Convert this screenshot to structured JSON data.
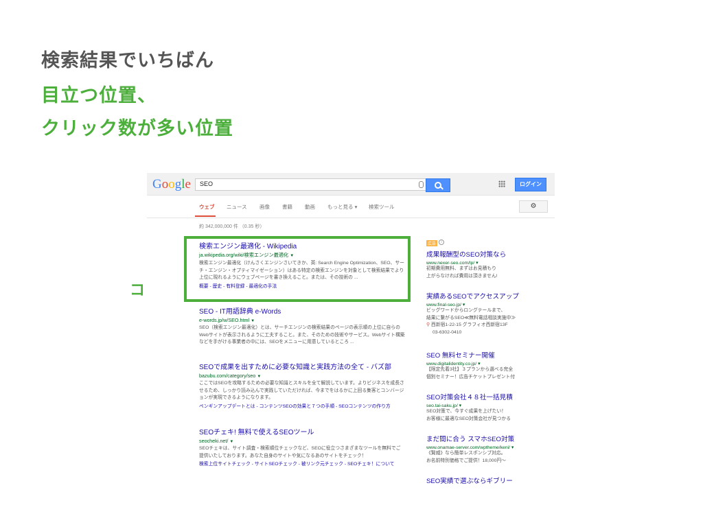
{
  "slide": {
    "line1": "検索結果でいちばん",
    "line2": "目立つ位置、",
    "line3": "クリック数が多い位置",
    "callout": "ココ！"
  },
  "google": {
    "logo_letters": [
      "G",
      "o",
      "o",
      "g",
      "l",
      "e"
    ],
    "logo_colors": [
      "#4285f4",
      "#ea4335",
      "#fbbc05",
      "#4285f4",
      "#34a853",
      "#ea4335"
    ],
    "query": "SEO",
    "login_label": "ログイン",
    "tabs": [
      "ウェブ",
      "ニュース",
      "画像",
      "書籍",
      "動画",
      "もっと見る ▾",
      "検索ツール"
    ],
    "settings_icon": "gear-icon",
    "stats": "約 342,000,000 件 （0.35 秒）"
  },
  "results": [
    {
      "title": "検索エンジン最適化 - Wikipedia",
      "url": "ja.wikipedia.org/wiki/検索エンジン最適化",
      "snippet": "検索エンジン最適化（けんさくエンジンさいてきか、英: Search Engine Optimization、SEO、サーチ・エンジン・オプティマイゼーション）はある特定の検索エンジンを対象として検索結果でより上位に現れるようにウェブページを書き換えること。または、その技術の ...",
      "sublinks": "概要 - 歴史 - 有料登録 - 最適化の手法"
    },
    {
      "title": "SEO - IT用語辞典 e-Words",
      "url": "e-words.jp/w/SEO.html",
      "snippet": "SEO（検索エンジン最適化）とは、サーチエンジンの検索結果のページの表示順の上位に自らのWebサイトが表示されるように工夫すること。また、そのための技術やサービス。Webサイト構築などを手がける事業者の中には、SEOをメニューに用意しているところ ...",
      "sublinks": ""
    },
    {
      "title": "SEOで成果を出すために必要な知識と実践方法の全て - バズ部",
      "url": "bazubu.com/category/seo",
      "snippet": "ここではSEOを攻略するための必要な知識とスキルを全て解説しています。よりビジネスを成長させるため、しっかり読み込んで実践していただければ、今までをはるかに上回る集客とコンバージョンが実現できるようになります。",
      "sublinks": "ペンギンアップデートとは - コンテンツSEOの効果と７つの手順 - SEOコンテンツの作り方"
    },
    {
      "title": "SEOチェキ! 無料で使えるSEOツール",
      "url": "seocheki.net/",
      "snippet": "SEOチェキは、サイト調査・検索順位チェックなど、SEOに役立つさまざまなツールを無料でご提供いたしております。あなた自身のサイトや気になるあのサイトをチェック！",
      "sublinks": "検索上位サイトチェック - サイトSEOチェック - 被リンク元チェック - SEOチェキ！について"
    }
  ],
  "ads": {
    "badge": "広告",
    "items": [
      {
        "title": "成果報酬型のSEO対策なら",
        "url": "www.nexer-seo.com/lp/",
        "lines": [
          "初期費用無料、まずはお見積もり",
          "上がらなければ費用は頂きません!"
        ]
      },
      {
        "title": "実績あるSEOでアクセスアップ",
        "url": "www.final-seo.jp/",
        "lines": [
          "ビッグワードからロングテールまで、",
          "結果に繋がるSEO≪無料電話相談実施中≫",
          "西新宿1-22-15 グラフィオ西新宿13F",
          "03-6302-0410"
        ]
      },
      {
        "title": "SEO 無料セミナー開催",
        "url": "www.digitalidentity.co.jp/",
        "lines": [
          "【限定先着3社】３プランから選べる完全",
          "個別セミナー！広告チケットプレゼント付"
        ]
      },
      {
        "title": "SEO対策会社４８社一括見積",
        "url": "seo.tai-saku.jp/",
        "lines": [
          "SEO対策で、今すぐ成果を上げたい！",
          "お客様に最適なSEO対策会社が見つかる"
        ]
      },
      {
        "title": "まだ間に合う スマホSEO対策",
        "url": "www.onamae-server.com/wptheme/keni/",
        "lines": [
          "《賢威》なら簡単レスポンシブ対応。",
          "お名前特別価格でご提供！18,000円〜"
        ]
      },
      {
        "title": "SEO実績で選ぶならギブリー",
        "url": "",
        "lines": []
      }
    ]
  }
}
